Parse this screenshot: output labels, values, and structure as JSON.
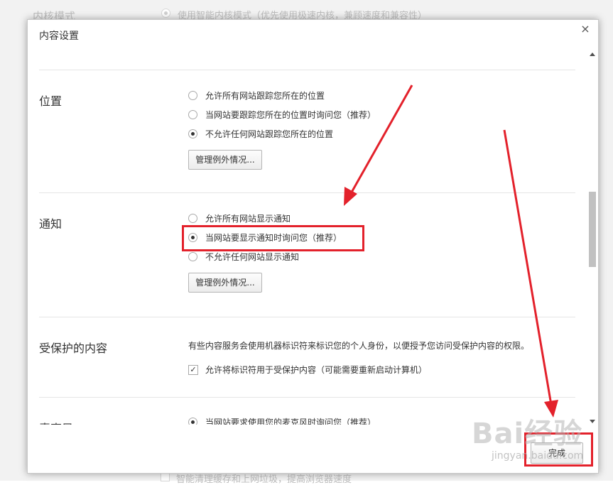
{
  "background": {
    "section_label": "内核模式",
    "top_option": "使用智能内核模式（优先使用极速内核，兼顾速度和兼容性）",
    "bottom_option": "智能清理缓存和上网垃圾，提高浏览器速度"
  },
  "dialog": {
    "title": "内容设置",
    "close_label": "×",
    "done_label": "完成",
    "sections": {
      "location": {
        "title": "位置",
        "options": [
          {
            "label": "允许所有网站跟踪您所在的位置",
            "checked": false
          },
          {
            "label": "当网站要跟踪您所在的位置时询问您（推荐）",
            "checked": false
          },
          {
            "label": "不允许任何网站跟踪您所在的位置",
            "checked": true
          }
        ],
        "manage_label": "管理例外情况..."
      },
      "notifications": {
        "title": "通知",
        "options": [
          {
            "label": "允许所有网站显示通知",
            "checked": false
          },
          {
            "label": "当网站要显示通知时询问您（推荐）",
            "checked": true
          },
          {
            "label": "不允许任何网站显示通知",
            "checked": false
          }
        ],
        "manage_label": "管理例外情况..."
      },
      "protected": {
        "title": "受保护的内容",
        "description": "有些内容服务会使用机器标识符来标识您的个人身份，以便授予您访问受保护内容的权限。",
        "checkbox_label": "允许将标识符用于受保护内容（可能需要重新启动计算机）",
        "checkbox_checked": true,
        "check_mark": "✓"
      },
      "microphone": {
        "title": "麦克风：",
        "options": [
          {
            "label": "当网站要求使用您的麦克风时询问您（推荐）",
            "checked": true
          }
        ]
      }
    }
  },
  "watermark": {
    "brand": "Bai经验",
    "site": "jingyan.baidu.com"
  },
  "colors": {
    "annotation_red": "#e3212b",
    "scroll_thumb": "#c1c1c1"
  }
}
